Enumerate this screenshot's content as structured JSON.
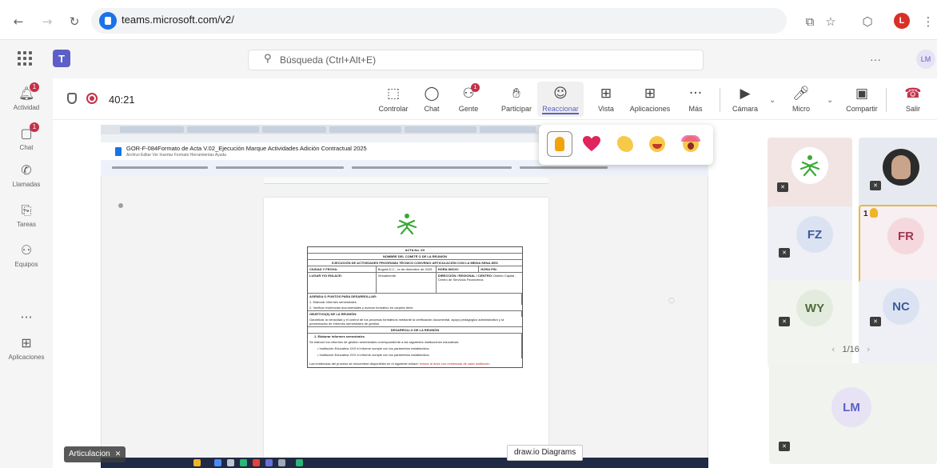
{
  "browser": {
    "url": "teams.microsoft.com/v2/",
    "profile_initial": "L"
  },
  "teams_header": {
    "search_placeholder": "Búsqueda (Ctrl+Alt+E)",
    "more_label": "···",
    "user_initials": "LM"
  },
  "rail": [
    {
      "label": "Actividad",
      "icon": "bell-icon",
      "badge": "1"
    },
    {
      "label": "Chat",
      "icon": "chat-icon",
      "badge": "1"
    },
    {
      "label": "Llamadas",
      "icon": "phone-icon"
    },
    {
      "label": "Tareas",
      "icon": "clipboard-icon"
    },
    {
      "label": "Equipos",
      "icon": "teams-icon"
    },
    {
      "label": "",
      "icon": "more-icon"
    },
    {
      "label": "Aplicaciones",
      "icon": "apps-icon"
    }
  ],
  "meeting": {
    "timer": "40:21",
    "toolbar": {
      "controlar": "Controlar",
      "chat": "Chat",
      "gente": "Gente",
      "gente_badge": "1",
      "participar": "Participar",
      "reaccionar": "Reaccionar",
      "vista": "Vista",
      "aplicaciones": "Aplicaciones",
      "mas": "Más",
      "camara": "Cámara",
      "micro": "Micro",
      "compartir": "Compartir",
      "salir": "Salir"
    }
  },
  "shared_doc": {
    "title": "GOR-F-084Formato de Acta V.02_Ejecución Marque Actividades Adición Contractual 2025",
    "menu": "Archivo  Editar  Ver  Insertar  Formato  Herramientas  Ayuda",
    "table": {
      "acta_no": "ACTA No. XX",
      "comite": "NOMBRE DEL COMITÉ O DE LA REUNIÓN",
      "ejecucion": "EJECUCIÓN DE ACTIVIDADES PROGRAMA TÉCNICO CONVENIO ARTICULACIÓN CON LA MEDIA SENA-SED",
      "ciudad_label": "CIUDAD Y FECHA:",
      "ciudad_value": "Bogotá D.C., xx de diciembre de 2025",
      "hora_inicio": "HORA INICIO:",
      "hora_fin": "HORA FIN:",
      "lugar_label": "LUGAR Y/O ENLACE:",
      "lugar_value": "Virtualmente",
      "direccion_label": "DIRECCIÓN / REGIONAL / CENTRO:",
      "direccion_value": "Distrito Capital - Centro de Servicios Financieros",
      "agenda_title": "AGENDA O PUNTOS PARA DESARROLLAR:",
      "agenda_1": "1. Elaborar informes semestrales",
      "agenda_2": "2. Verificar evidencias documentales y avance formativo en carpeta drive.",
      "objetivo_title": "OBJETIVO(S) DE LA REUNIÓN:",
      "objetivo_text": "Garantizar la veracidad y el control de los procesos formativos mediante la verificación documental, apoyo pedagógico administrativo y la presentación de informes semestrales de gestión.",
      "desarrollo_title": "DESARROLLO DE LA REUNIÓN",
      "item_1": "1.  Elaborar informes semestrales",
      "item_1_text": "Se elaboró los informes de gestión semestrales correspondiente a las siguientes instituciones educativas:",
      "bullet_1": "Institución Educativa XXX el informe cumple con los parámetros establecidos.",
      "bullet_2": "Institución Educativa XXX el informe cumple con los parámetros establecidos.",
      "evidence_text": "Las evidencias del proceso se encuentran disponibles en el siguiente enlace:",
      "evidence_red": "enlace al drive con evidencias de cada institución"
    }
  },
  "participants": {
    "tiles": [
      {
        "initials": "",
        "kind": "logo"
      },
      {
        "initials": "",
        "kind": "photo"
      },
      {
        "initials": "FZ"
      },
      {
        "initials": "FR",
        "raised_hand_count": "1",
        "highlighted": true
      },
      {
        "initials": "WY"
      },
      {
        "initials": "NC"
      },
      {
        "initials": "LM"
      }
    ],
    "pager": "1/16"
  },
  "self_view": {
    "label": "Articulacion"
  },
  "tooltip": "draw.io Diagrams",
  "reactions": [
    "like-icon",
    "heart-icon",
    "clap-icon",
    "laugh-icon",
    "surprised-icon"
  ],
  "colors": {
    "teams_purple": "#5b5fc7",
    "leave_red": "#c4314b",
    "sena_green": "#39a935",
    "hand_yellow": "#e8b847"
  }
}
